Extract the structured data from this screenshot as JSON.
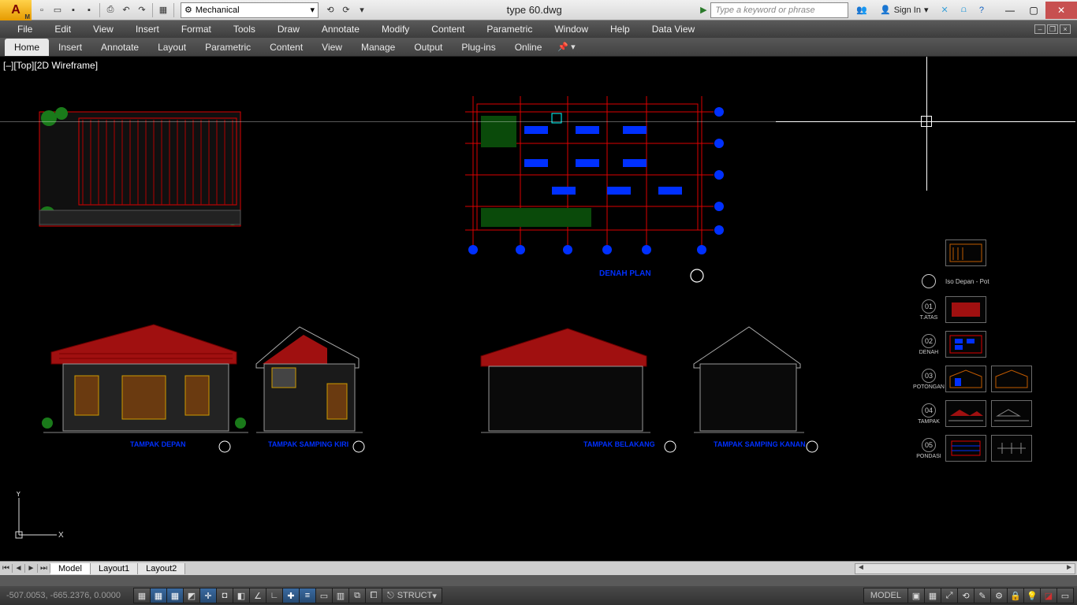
{
  "title": "type 60.dwg",
  "workspace": "Mechanical",
  "search_placeholder": "Type a keyword or phrase",
  "signin": "Sign In",
  "menu": [
    "File",
    "Edit",
    "View",
    "Insert",
    "Format",
    "Tools",
    "Draw",
    "Annotate",
    "Modify",
    "Content",
    "Parametric",
    "Window",
    "Help",
    "Data View"
  ],
  "ribbon": [
    "Home",
    "Insert",
    "Annotate",
    "Layout",
    "Parametric",
    "Content",
    "View",
    "Manage",
    "Output",
    "Plug-ins",
    "Online"
  ],
  "ribbon_active": "Home",
  "viewport_label": "[–][Top][2D Wireframe]",
  "layout_tabs": [
    "Model",
    "Layout1",
    "Layout2"
  ],
  "layout_active": "Model",
  "coords": "-507.0053, -665.2376, 0.0000",
  "struct_label": "STRUCT",
  "model_label": "MODEL",
  "drawing_labels": {
    "plan": "DENAH PLAN",
    "front": "TAMPAK DEPAN",
    "left": "TAMPAK SAMPING KIRI",
    "back": "TAMPAK BELAKANG",
    "right": "TAMPAK SAMPING KANAN"
  },
  "nav": {
    "legend": "Iso Depan - Pot",
    "items": [
      {
        "n": "01",
        "l": "T.ATAS"
      },
      {
        "n": "02",
        "l": "DENAH"
      },
      {
        "n": "03",
        "l": "POTONGAN"
      },
      {
        "n": "04",
        "l": "TAMPAK"
      },
      {
        "n": "05",
        "l": "PONDASI"
      }
    ]
  }
}
